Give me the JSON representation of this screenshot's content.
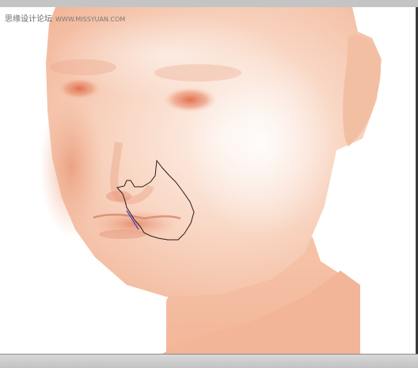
{
  "watermark": {
    "forum_name": "思缘设计论坛",
    "site_url": "WWW.MISSYUAN.COM"
  },
  "colors": {
    "skin_base": "#f6c9b0",
    "skin_light": "#fbe6da",
    "skin_shadow": "#e9a88b",
    "eye": "#e07a5a",
    "lip": "#e29a80",
    "lasso_stroke": "#2a1a14",
    "pen_path": "#4a3bd1",
    "toolbar_gray": "#c4c4c4"
  }
}
